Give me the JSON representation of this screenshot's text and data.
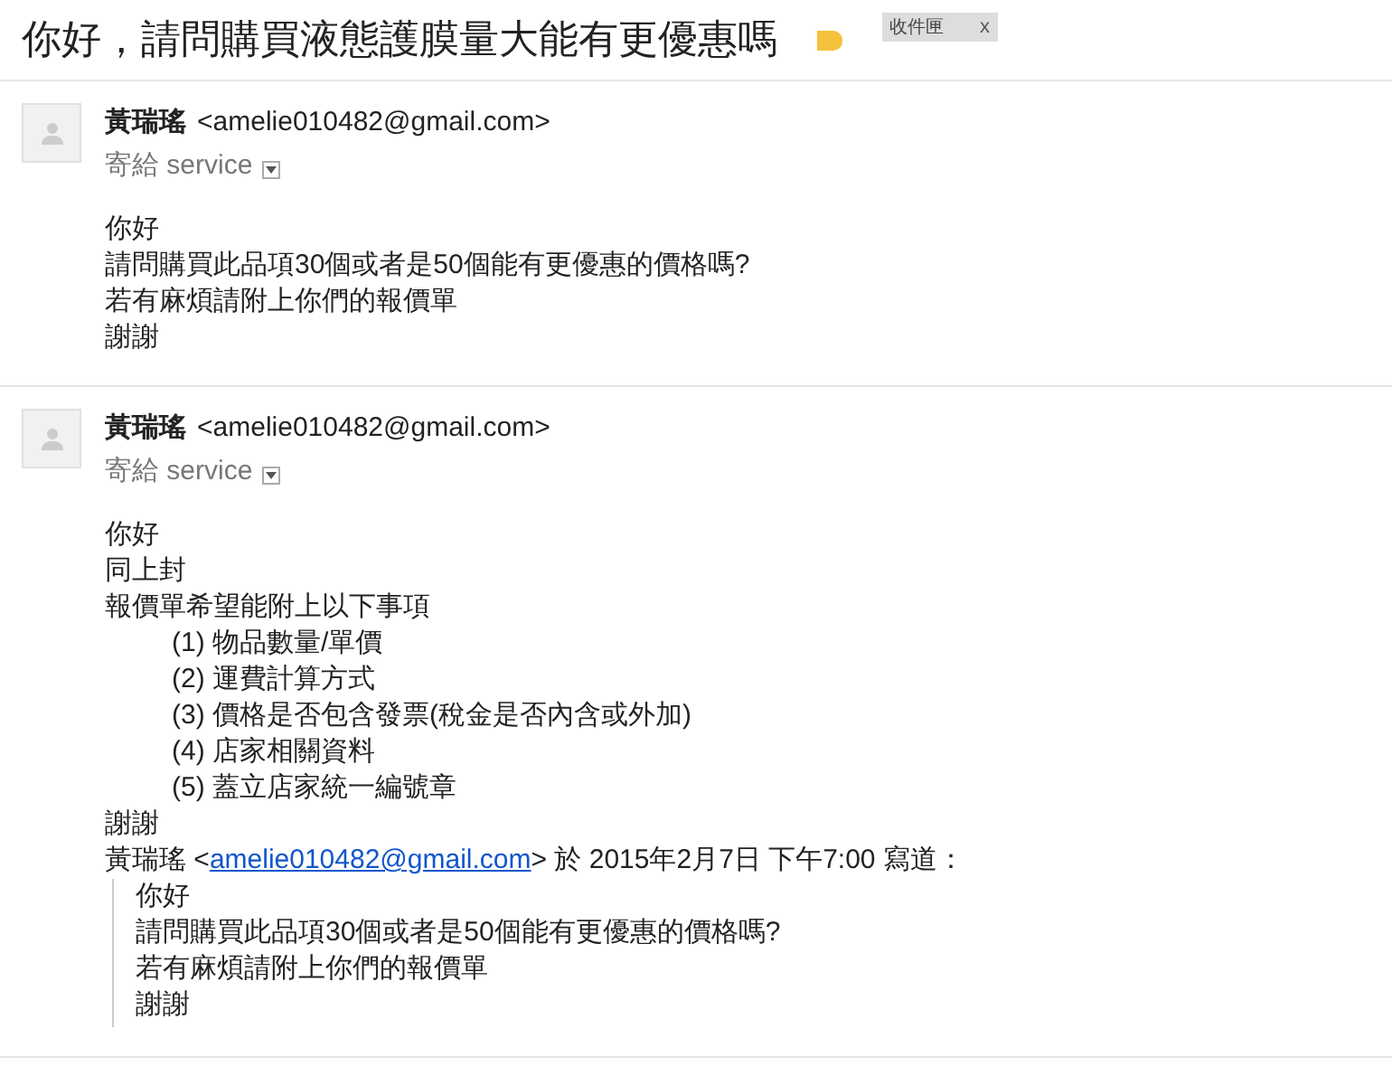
{
  "subject": "你好，請問購買液態護膜量大能有更優惠嗎",
  "label_tag": {
    "text": "收件匣",
    "close": "x"
  },
  "messages": [
    {
      "sender_name": "黃瑞瑤",
      "sender_email": "<amelie010482@gmail.com>",
      "recipient": "寄給 service",
      "body": [
        {
          "kind": "text",
          "text": "你好"
        },
        {
          "kind": "text",
          "text": "請問購買此品項30個或者是50個能有更優惠的價格嗎?"
        },
        {
          "kind": "text",
          "text": "若有麻煩請附上你們的報價單"
        },
        {
          "kind": "text",
          "text": "謝謝"
        }
      ]
    },
    {
      "sender_name": "黃瑞瑤",
      "sender_email": "<amelie010482@gmail.com>",
      "recipient": "寄給 service",
      "body": [
        {
          "kind": "text",
          "text": "你好"
        },
        {
          "kind": "text",
          "text": "同上封"
        },
        {
          "kind": "text",
          "text": "報價單希望能附上以下事項"
        },
        {
          "kind": "item",
          "text": "(1) 物品數量/單價"
        },
        {
          "kind": "item",
          "text": "(2) 運費計算方式"
        },
        {
          "kind": "item",
          "text": "(3) 價格是否包含發票(稅金是否內含或外加)"
        },
        {
          "kind": "item",
          "text": "(4) 店家相關資料"
        },
        {
          "kind": "item",
          "text": "(5) 蓋立店家統一編號章"
        },
        {
          "kind": "text",
          "text": "謝謝"
        }
      ],
      "quote": {
        "prefix": "黃瑞瑤 <",
        "link": "amelie010482@gmail.com",
        "suffix": "> 於 2015年2月7日 下午7:00 寫道：",
        "lines": [
          "你好",
          "請問購買此品項30個或者是50個能有更優惠的價格嗎?",
          "若有麻煩請附上你們的報價單",
          "謝謝"
        ]
      }
    }
  ]
}
